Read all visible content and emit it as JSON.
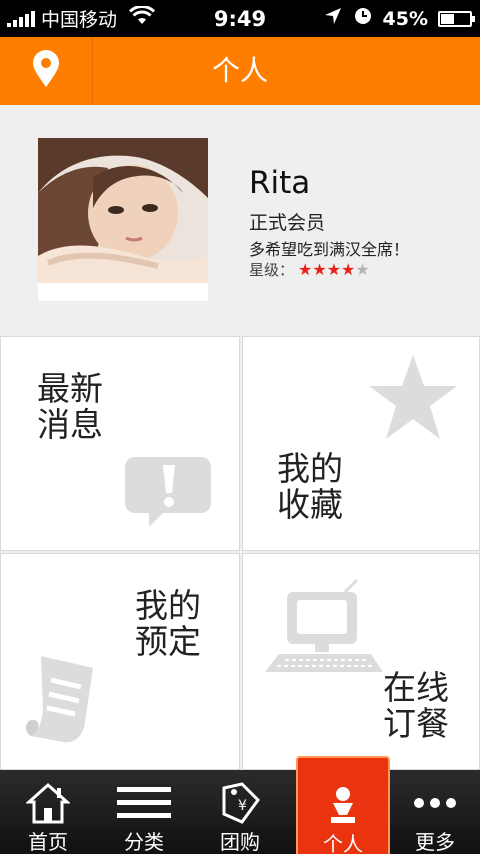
{
  "status_bar": {
    "carrier": "中国移动",
    "time": "9:49",
    "battery": "45%",
    "battery_fraction": 0.45
  },
  "header": {
    "title": "个人"
  },
  "profile": {
    "name": "Rita",
    "level": "正式会员",
    "motto": "多希望吃到满汉全席！",
    "rating_label": "星级：",
    "rating": 4,
    "rating_max": 5
  },
  "tiles": {
    "messages": "最新\n消息",
    "favorites": "我的\n收藏",
    "reservations": "我的\n预定",
    "online_order": "在线\n订餐"
  },
  "tabs": [
    "首页",
    "分类",
    "团购",
    "个人",
    "更多"
  ],
  "colors": {
    "accent": "#ff7e00",
    "active_tab": "#e9340f",
    "star_on": "#e8221a",
    "star_off": "#b5b5b5"
  }
}
